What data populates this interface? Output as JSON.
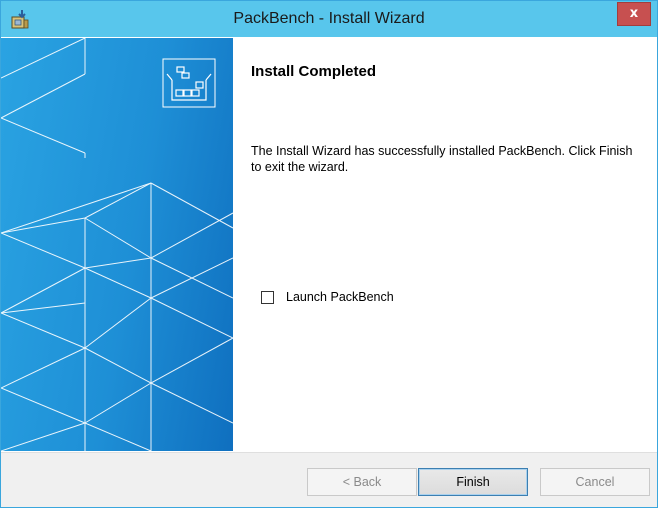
{
  "window": {
    "title": "PackBench - Install Wizard",
    "close_label": "x",
    "icon": "installer-icon"
  },
  "banner": {
    "logo_icon": "package-boxes-icon",
    "pattern": "triangle-grid",
    "colors": {
      "gradient_start": "#2aa3e2",
      "gradient_end": "#0f6fbf",
      "lines": "#ffffff"
    }
  },
  "content": {
    "heading": "Install Completed",
    "message": "The Install Wizard has successfully installed PackBench. Click Finish to exit the wizard.",
    "launch_checkbox": {
      "label": "Launch PackBench",
      "checked": false
    }
  },
  "footer": {
    "back_label": "< Back",
    "finish_label": "Finish",
    "cancel_label": "Cancel",
    "back_enabled": false,
    "finish_enabled": true,
    "cancel_enabled": false
  },
  "colors": {
    "titlebar": "#58c6ec",
    "close_button": "#c75050",
    "footer_bg": "#f0f0f0"
  }
}
